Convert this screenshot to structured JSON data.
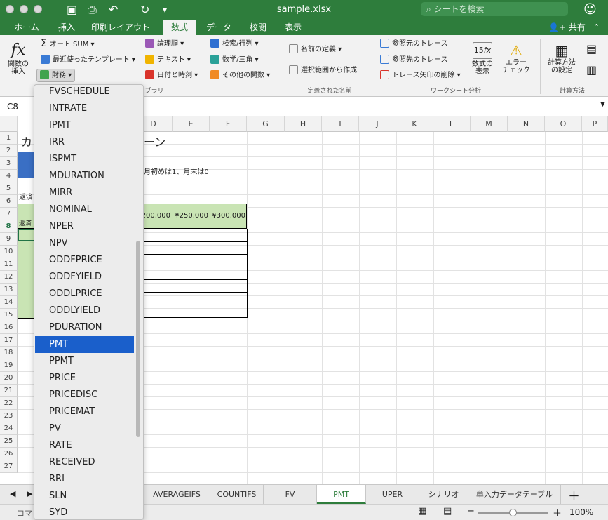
{
  "window": {
    "title": "sample.xlsx",
    "search_placeholder": "シートを検索"
  },
  "ribbon_tabs": [
    "ホーム",
    "挿入",
    "印刷レイアウト",
    "数式",
    "データ",
    "校閲",
    "表示"
  ],
  "share_label": "共有",
  "ribbon": {
    "insert_function": "関数の\n挿入",
    "autosum": "オート SUM",
    "recent": "最近使ったテンプレート",
    "financial": "財務",
    "logical": "論理順",
    "text": "テキスト",
    "datetime": "日付と時刻",
    "lookup": "検索/行列",
    "math": "数学/三角",
    "other": "その他の関数",
    "library_label": "ブラリ",
    "define_name": "名前の定義",
    "create_from_selection": "選択範囲から作成",
    "defined_names_label": "定義された名前",
    "trace_precedents": "参照元のトレース",
    "trace_dependents": "参照先のトレース",
    "remove_arrows": "トレース矢印の削除",
    "show_formulas": "数式の\n表示",
    "error_check": "エラー\nチェック",
    "audit_label": "ワークシート分析",
    "calc_options": "計算方法\nの設定",
    "calc_label": "計算方法"
  },
  "formula_bar": {
    "name_box": "C8"
  },
  "columns": [
    "D",
    "E",
    "F",
    "G",
    "H",
    "I",
    "J",
    "K",
    "L",
    "M",
    "N",
    "O",
    "P"
  ],
  "rows": [
    "1",
    "2",
    "3",
    "4",
    "5",
    "6",
    "7",
    "8",
    "9",
    "10",
    "11",
    "12",
    "13",
    "14",
    "15",
    "16",
    "17",
    "18",
    "19",
    "20",
    "21",
    "22",
    "23",
    "24",
    "25",
    "26",
    "27"
  ],
  "cells": {
    "a1": "カ",
    "d1": "ーン",
    "d3": "月初めは1、月末は0",
    "a5": "返済",
    "a7": "返済",
    "d7": "200,000",
    "e7": "¥250,000",
    "f7": "¥300,000"
  },
  "dropdown": {
    "items": [
      "FVSCHEDULE",
      "INTRATE",
      "IPMT",
      "IRR",
      "ISPMT",
      "MDURATION",
      "MIRR",
      "NOMINAL",
      "NPER",
      "NPV",
      "ODDFPRICE",
      "ODDFYIELD",
      "ODDLPRICE",
      "ODDLYIELD",
      "PDURATION",
      "PMT",
      "PPMT",
      "PRICE",
      "PRICEDISC",
      "PRICEMAT",
      "PV",
      "RATE",
      "RECEIVED",
      "RRI",
      "SLN",
      "SYD"
    ],
    "selected": "PMT"
  },
  "sheet_tabs": [
    "AVERAGEIFS",
    "COUNTIFS",
    "FV",
    "PMT",
    "UPER",
    "シナリオ",
    "単入力データテーブル"
  ],
  "active_sheet": "PMT",
  "status": {
    "mode": "コマ",
    "zoom": "100%"
  }
}
